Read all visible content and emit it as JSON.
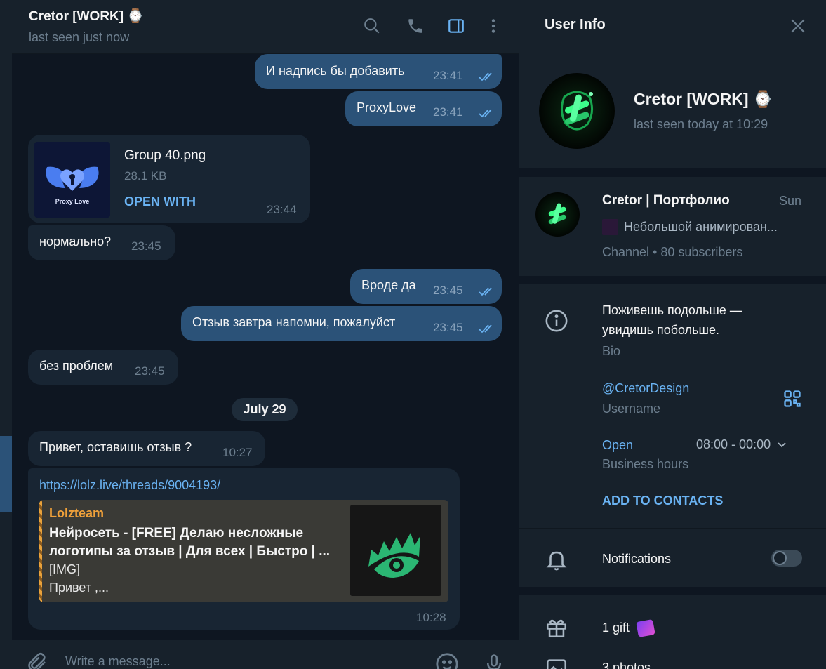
{
  "chat": {
    "title": "Cretor [WORK] ⌚",
    "status": "last seen just now",
    "composer_placeholder": "Write a message..."
  },
  "messages": [
    {
      "text": "И надпись бы добавить",
      "time": "23:41",
      "out": true
    },
    {
      "text": "ProxyLove",
      "time": "23:41",
      "out": true
    },
    {
      "file_name": "Group 40.png",
      "file_size": "28.1 KB",
      "action": "OPEN WITH",
      "time": "23:44",
      "thumb_label": "Proxy Love"
    },
    {
      "text": "нормально?",
      "time": "23:45",
      "out": false
    },
    {
      "text": "Вроде да",
      "time": "23:45",
      "out": true
    },
    {
      "text": "Отзыв завтра напомни, пожалуйст",
      "time": "23:45",
      "out": true
    },
    {
      "text": "без проблем",
      "time": "23:45",
      "out": false
    },
    {
      "date": "July 29"
    },
    {
      "text": "Привет, оставишь отзыв ?",
      "time": "10:27",
      "out": false
    },
    {
      "url": "https://lolz.live/threads/9004193/",
      "site": "Lolzteam",
      "title": "Нейросеть - [FREE] Делаю несложные логотипы за отзыв | Для всех | Быстро | ...",
      "desc_line1": "[IMG]",
      "desc_line2": "Привет ,...",
      "time": "10:28",
      "out": false
    }
  ],
  "info": {
    "header": "User Info",
    "name": "Cretor [WORK] ⌚",
    "last_seen": "last seen today at 10:29",
    "channel": {
      "name": "Cretor | Портфолио",
      "date": "Sun",
      "last_message": "Небольшой анимирован...",
      "meta": "Channel • 80 subscribers"
    },
    "bio_line1": "Поживешь подольше —",
    "bio_line2": "увидишь побольше.",
    "bio_label": "Bio",
    "username": "@CretorDesign",
    "username_label": "Username",
    "hours_status": "Open",
    "hours_value": "08:00 - 00:00",
    "hours_label": "Business hours",
    "add_contacts": "ADD TO CONTACTS",
    "notifications": "Notifications",
    "notifications_on": false,
    "gifts": "1 gift",
    "photos": "3 photos"
  },
  "colors": {
    "accent": "#6ab3f3",
    "outgoing_bubble": "#2b5278",
    "incoming_bubble": "#182533",
    "background": "#0e1621",
    "panel": "#17212b"
  }
}
